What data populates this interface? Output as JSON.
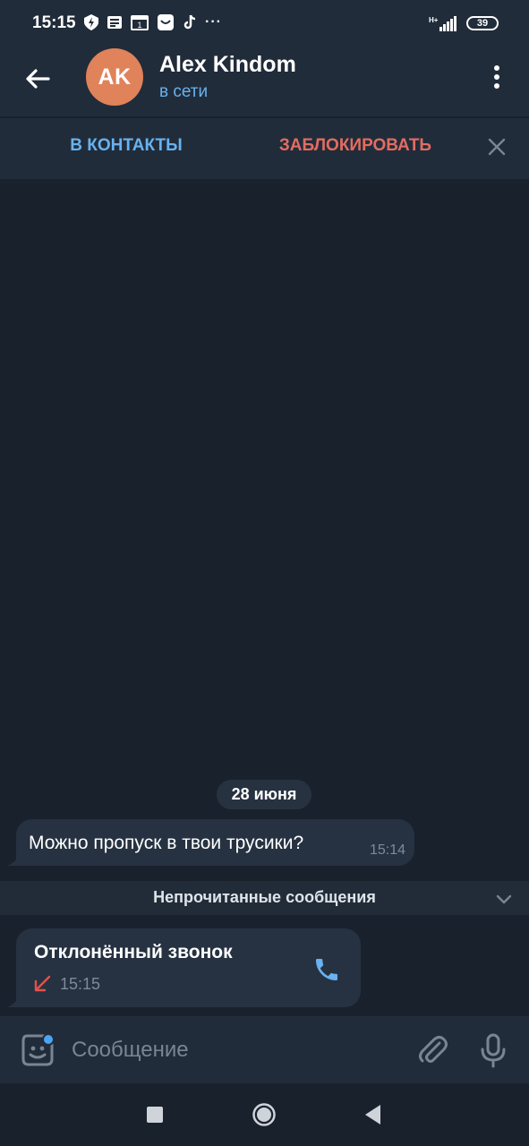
{
  "status_bar": {
    "time": "15:15",
    "network": "H+",
    "battery": "39",
    "overflow": "···"
  },
  "header": {
    "avatar_initials": "AK",
    "avatar_color": "#e0825a",
    "name": "Alex Kindom",
    "status": "в сети"
  },
  "action_bar": {
    "add_contact": "В КОНТАКТЫ",
    "block": "ЗАБЛОКИРОВАТЬ"
  },
  "chat": {
    "date_label": "28 июня",
    "messages": [
      {
        "text": "Можно пропуск в твои трусики?",
        "time": "15:14"
      }
    ],
    "unread_label": "Непрочитанные сообщения",
    "call": {
      "title": "Отклонённый звонок",
      "time": "15:15"
    }
  },
  "composer": {
    "placeholder": "Сообщение"
  },
  "colors": {
    "accent": "#68b2ef",
    "danger": "#e36c62",
    "background": "#19212d",
    "panel": "#212c3a",
    "bubble": "#263241"
  }
}
